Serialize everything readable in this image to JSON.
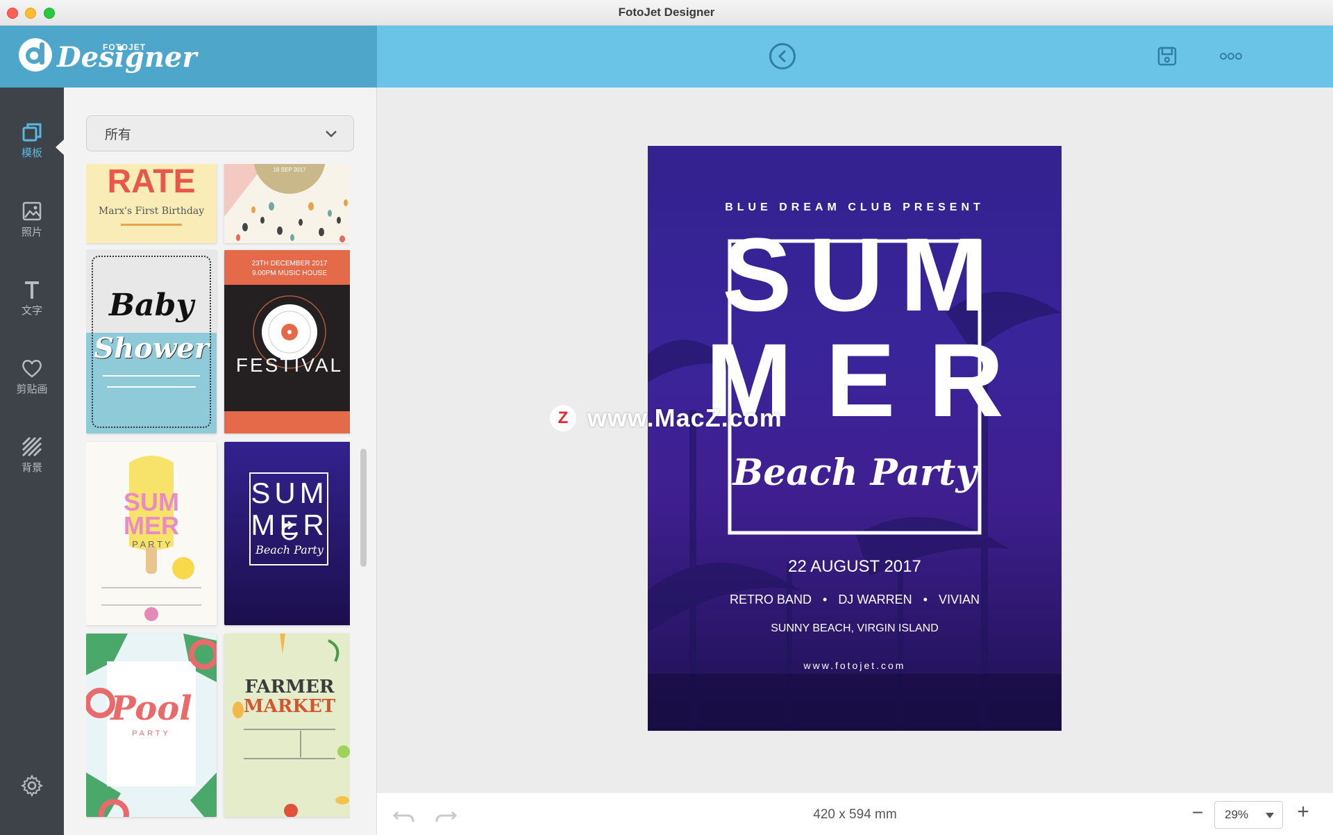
{
  "window": {
    "title": "FotoJet Designer"
  },
  "logo": {
    "small": "FOTOJET",
    "main": "Designer"
  },
  "header": {
    "more_label": "ooo"
  },
  "sidebar": {
    "items": [
      {
        "label": "模板",
        "icon": "template-icon"
      },
      {
        "label": "照片",
        "icon": "photo-icon"
      },
      {
        "label": "文字",
        "icon": "text-icon"
      },
      {
        "label": "剪贴画",
        "icon": "heart-icon"
      },
      {
        "label": "背景",
        "icon": "background-icon"
      }
    ],
    "settings_icon": "gear-icon"
  },
  "panel": {
    "filter": {
      "selected": "所有"
    },
    "templates": [
      {
        "t1": "RATE",
        "t2": "Marx's First Birthday"
      },
      {
        "t1": "18 SEP 2017"
      },
      {
        "t1": "Baby",
        "t2": "Shower"
      },
      {
        "t1": "23TH DECEMBER 2017",
        "t2": "9.00PM MUSIC HOUSE",
        "t3": "FESTIVAL"
      },
      {
        "t1": "SUM",
        "t2": "MER",
        "t3": "P A R T Y"
      },
      {
        "t1": "SUM",
        "t2": "MER",
        "t3": "Beach Party"
      },
      {
        "t1": "Pool",
        "t2": "PARTY"
      },
      {
        "t1": "FARMER",
        "t2": "MARKET"
      }
    ]
  },
  "poster": {
    "presenter": "BLUE DREAM CLUB PRESENT",
    "title_line1": "SUM",
    "title_line2": "MER",
    "script": "Beach Party",
    "date": "22 AUGUST 2017",
    "band1": "RETRO BAND",
    "band2": "DJ WARREN",
    "band3": "VIVIAN",
    "location": "SUNNY BEACH, VIRGIN ISLAND",
    "website": "www.fotojet.com"
  },
  "watermark": {
    "badge": "Z",
    "text": "www.MacZ.com"
  },
  "bottombar": {
    "dimensions": "420 x 594 mm",
    "zoom": "29%",
    "minus": "−",
    "plus": "+"
  },
  "colors": {
    "header_left": "#4ea7cb",
    "header_right": "#6ac4e8",
    "sidebar": "#3d4349",
    "accent": "#5ab8df"
  }
}
